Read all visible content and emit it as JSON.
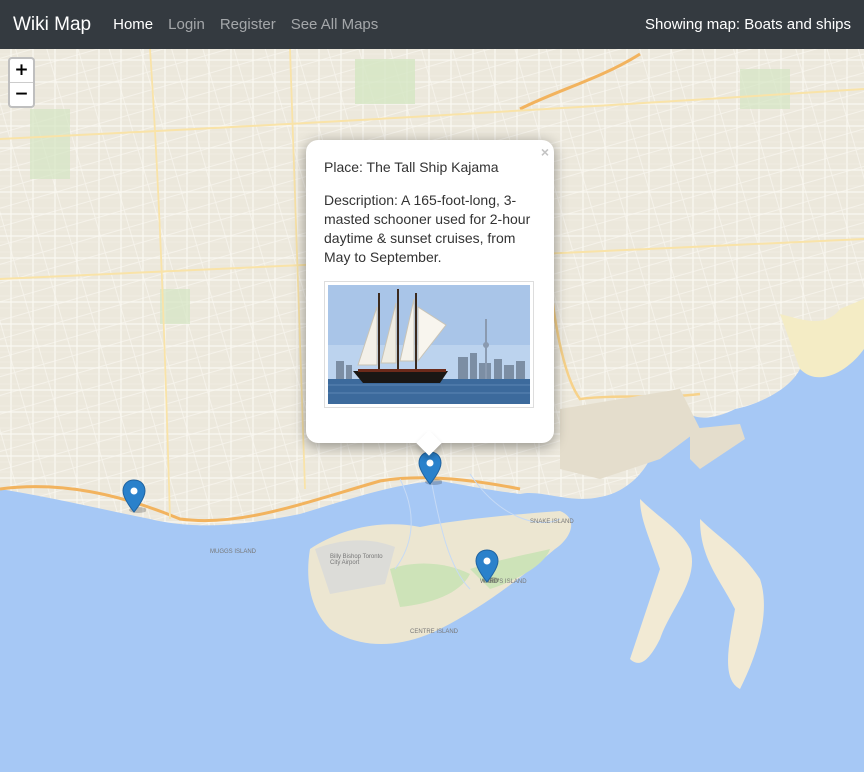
{
  "navbar": {
    "brand": "Wiki Map",
    "links": [
      "Home",
      "Login",
      "Register",
      "See All Maps"
    ],
    "status": "Showing map: Boats and ships"
  },
  "zoom": {
    "in": "+",
    "out": "−"
  },
  "popup": {
    "close": "×",
    "place": "Place: The Tall Ship Kajama",
    "description": "Description: A 165-foot-long, 3-masted schooner used for 2-hour daytime & sunset cruises, from May to September."
  },
  "map_labels": {
    "island1": "CENTRE ISLAND",
    "island2": "WARD'S ISLAND",
    "airport": "Billy Bishop Toronto City Airport",
    "island3": "MUGGS ISLAND",
    "island4": "SNAKE ISLAND"
  },
  "colors": {
    "navbar": "#343a40",
    "water": "#a6c8f5",
    "land": "#ebe6d9",
    "marker": "#2a81cb"
  }
}
